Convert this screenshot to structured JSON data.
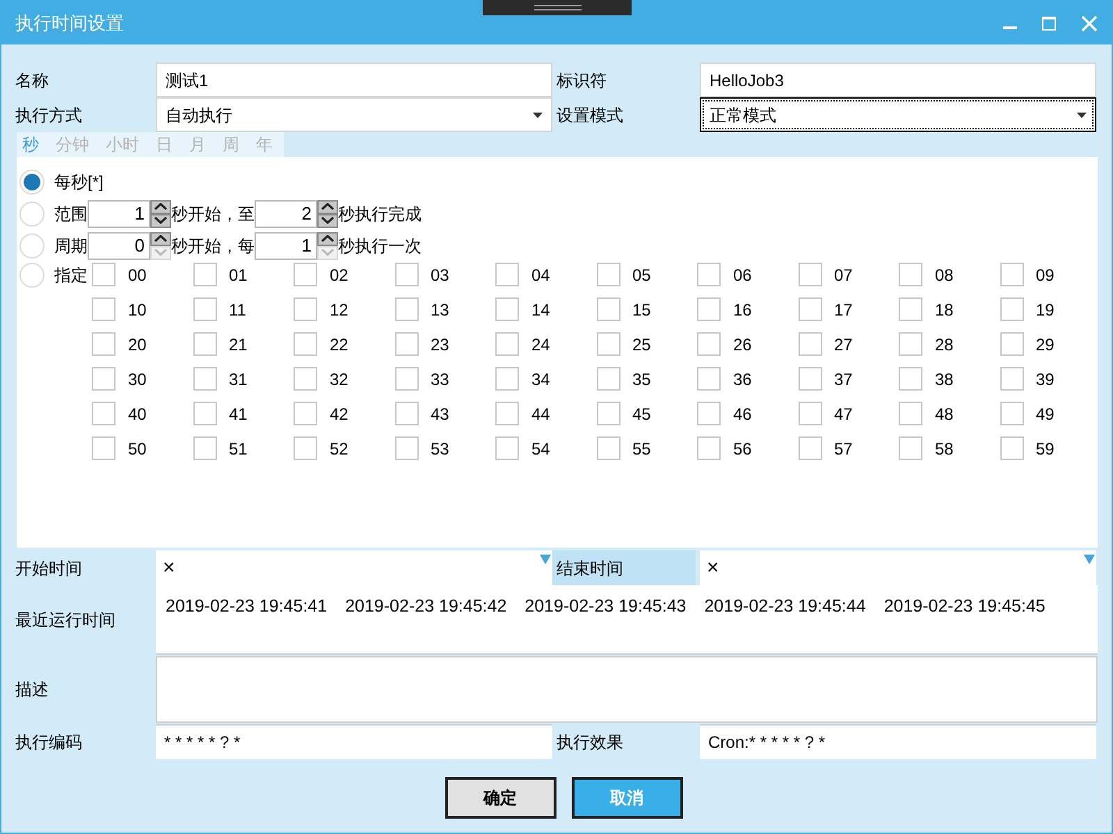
{
  "window": {
    "title": "执行时间设置"
  },
  "fields": [
    {
      "label": "名称",
      "value": "测试1"
    },
    {
      "label": "标识符",
      "value": "HelloJob3"
    }
  ],
  "selects": [
    {
      "label": "执行方式",
      "value": "自动执行",
      "focused": false
    },
    {
      "label": "设置模式",
      "value": "正常模式",
      "focused": true
    }
  ],
  "tabs": [
    {
      "label": "秒",
      "selected": true
    },
    {
      "label": "分钟",
      "selected": false
    },
    {
      "label": "小时",
      "selected": false
    },
    {
      "label": "日",
      "selected": false
    },
    {
      "label": "月",
      "selected": false
    },
    {
      "label": "周",
      "selected": false
    },
    {
      "label": "年",
      "selected": false
    }
  ],
  "options": [
    {
      "kind": "plain",
      "label": "每秒[*]",
      "selected": true
    },
    {
      "kind": "spin",
      "label": "范围",
      "selected": false,
      "spin_a": {
        "value": "1",
        "can_decrease": true
      },
      "text_a": "秒开始，至",
      "spin_b": {
        "value": "2",
        "can_decrease": true
      },
      "text_b": "秒执行完成"
    },
    {
      "kind": "spin",
      "label": "周期",
      "selected": false,
      "spin_a": {
        "value": "0",
        "can_decrease": false
      },
      "text_a": "秒开始，每",
      "spin_b": {
        "value": "1",
        "can_decrease": false
      },
      "text_b": "秒执行一次"
    },
    {
      "kind": "list",
      "label": "指定",
      "selected": false,
      "items": [
        {
          "label": "00",
          "checked": false
        },
        {
          "label": "01",
          "checked": false
        },
        {
          "label": "02",
          "checked": false
        },
        {
          "label": "03",
          "checked": false
        },
        {
          "label": "04",
          "checked": false
        },
        {
          "label": "05",
          "checked": false
        },
        {
          "label": "06",
          "checked": false
        },
        {
          "label": "07",
          "checked": false
        },
        {
          "label": "08",
          "checked": false
        },
        {
          "label": "09",
          "checked": false
        },
        {
          "label": "10",
          "checked": false
        },
        {
          "label": "11",
          "checked": false
        },
        {
          "label": "12",
          "checked": false
        },
        {
          "label": "13",
          "checked": false
        },
        {
          "label": "14",
          "checked": false
        },
        {
          "label": "15",
          "checked": false
        },
        {
          "label": "16",
          "checked": false
        },
        {
          "label": "17",
          "checked": false
        },
        {
          "label": "18",
          "checked": false
        },
        {
          "label": "19",
          "checked": false
        },
        {
          "label": "20",
          "checked": false
        },
        {
          "label": "21",
          "checked": false
        },
        {
          "label": "22",
          "checked": false
        },
        {
          "label": "23",
          "checked": false
        },
        {
          "label": "24",
          "checked": false
        },
        {
          "label": "25",
          "checked": false
        },
        {
          "label": "26",
          "checked": false
        },
        {
          "label": "27",
          "checked": false
        },
        {
          "label": "28",
          "checked": false
        },
        {
          "label": "29",
          "checked": false
        },
        {
          "label": "30",
          "checked": false
        },
        {
          "label": "31",
          "checked": false
        },
        {
          "label": "32",
          "checked": false
        },
        {
          "label": "33",
          "checked": false
        },
        {
          "label": "34",
          "checked": false
        },
        {
          "label": "35",
          "checked": false
        },
        {
          "label": "36",
          "checked": false
        },
        {
          "label": "37",
          "checked": false
        },
        {
          "label": "38",
          "checked": false
        },
        {
          "label": "39",
          "checked": false
        },
        {
          "label": "40",
          "checked": false
        },
        {
          "label": "41",
          "checked": false
        },
        {
          "label": "42",
          "checked": false
        },
        {
          "label": "43",
          "checked": false
        },
        {
          "label": "44",
          "checked": false
        },
        {
          "label": "45",
          "checked": false
        },
        {
          "label": "46",
          "checked": false
        },
        {
          "label": "47",
          "checked": false
        },
        {
          "label": "48",
          "checked": false
        },
        {
          "label": "49",
          "checked": false
        },
        {
          "label": "50",
          "checked": false
        },
        {
          "label": "51",
          "checked": false
        },
        {
          "label": "52",
          "checked": false
        },
        {
          "label": "53",
          "checked": false
        },
        {
          "label": "54",
          "checked": false
        },
        {
          "label": "55",
          "checked": false
        },
        {
          "label": "56",
          "checked": false
        },
        {
          "label": "57",
          "checked": false
        },
        {
          "label": "58",
          "checked": false
        },
        {
          "label": "59",
          "checked": false
        }
      ]
    }
  ],
  "start_time": {
    "label": "开始时间",
    "value": "×"
  },
  "end_time": {
    "label": "结束时间",
    "value": "×"
  },
  "recent": {
    "label": "最近运行时间",
    "times": [
      "2019-02-23 19:45:41",
      "2019-02-23 19:45:42",
      "2019-02-23 19:45:43",
      "2019-02-23 19:45:44",
      "2019-02-23 19:45:45"
    ]
  },
  "description": {
    "label": "描述"
  },
  "code": {
    "label": "执行编码",
    "value": "* * * * * ? *"
  },
  "effect": {
    "label": "执行效果",
    "value": "Cron:* * * * * ? *"
  },
  "buttons": [
    {
      "label": "确定",
      "kind": "secondary"
    },
    {
      "label": "取消",
      "kind": "primary"
    }
  ]
}
